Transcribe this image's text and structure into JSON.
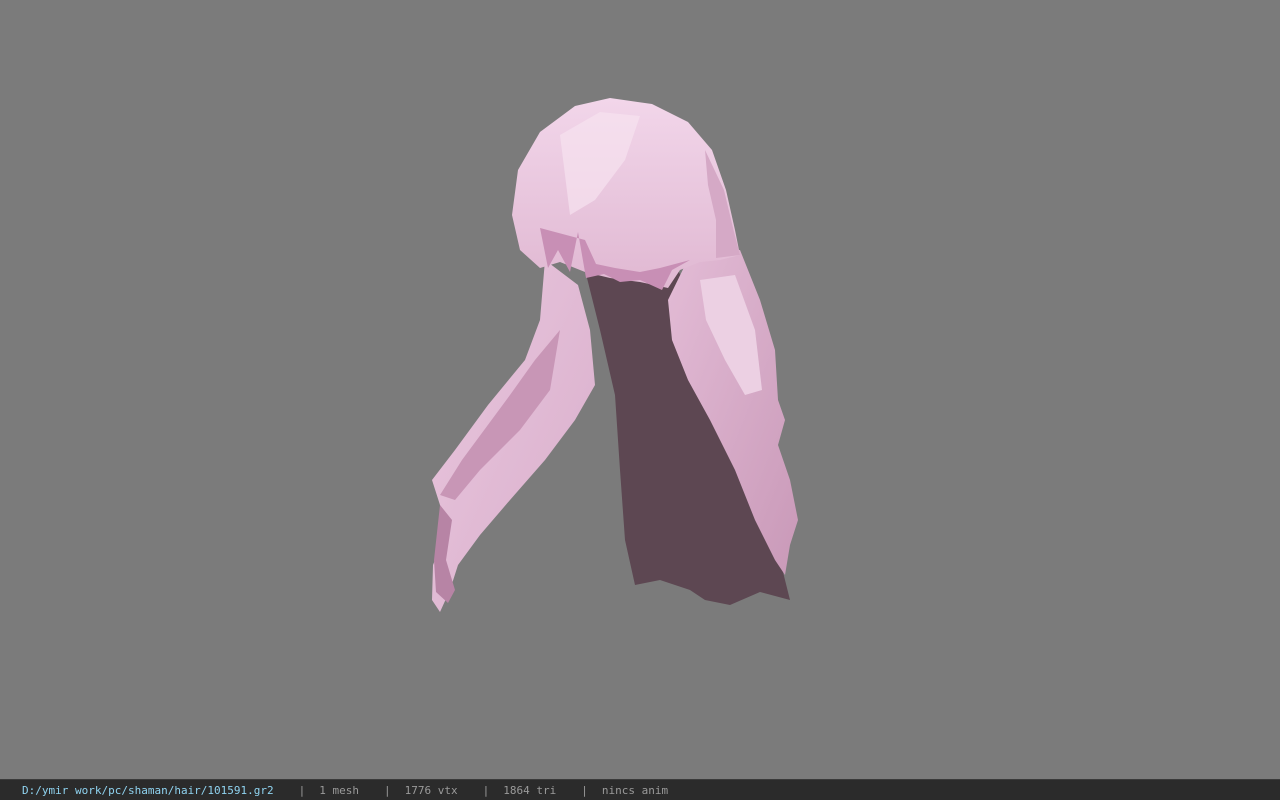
{
  "viewer": {
    "background_color": "#7b7b7b",
    "model_icon": "hair-mesh",
    "model_colors": {
      "light": "#e8c4dc",
      "mid": "#d6a8c6",
      "dark": "#5a454f"
    }
  },
  "status_bar": {
    "file_path": "D:/ymir work/pc/shaman/hair/101591.gr2",
    "separator": "|",
    "mesh_count": "1 mesh",
    "vertex_count": "1776 vtx",
    "triangle_count": "1864 tri",
    "anim_status": "nincs anim"
  }
}
